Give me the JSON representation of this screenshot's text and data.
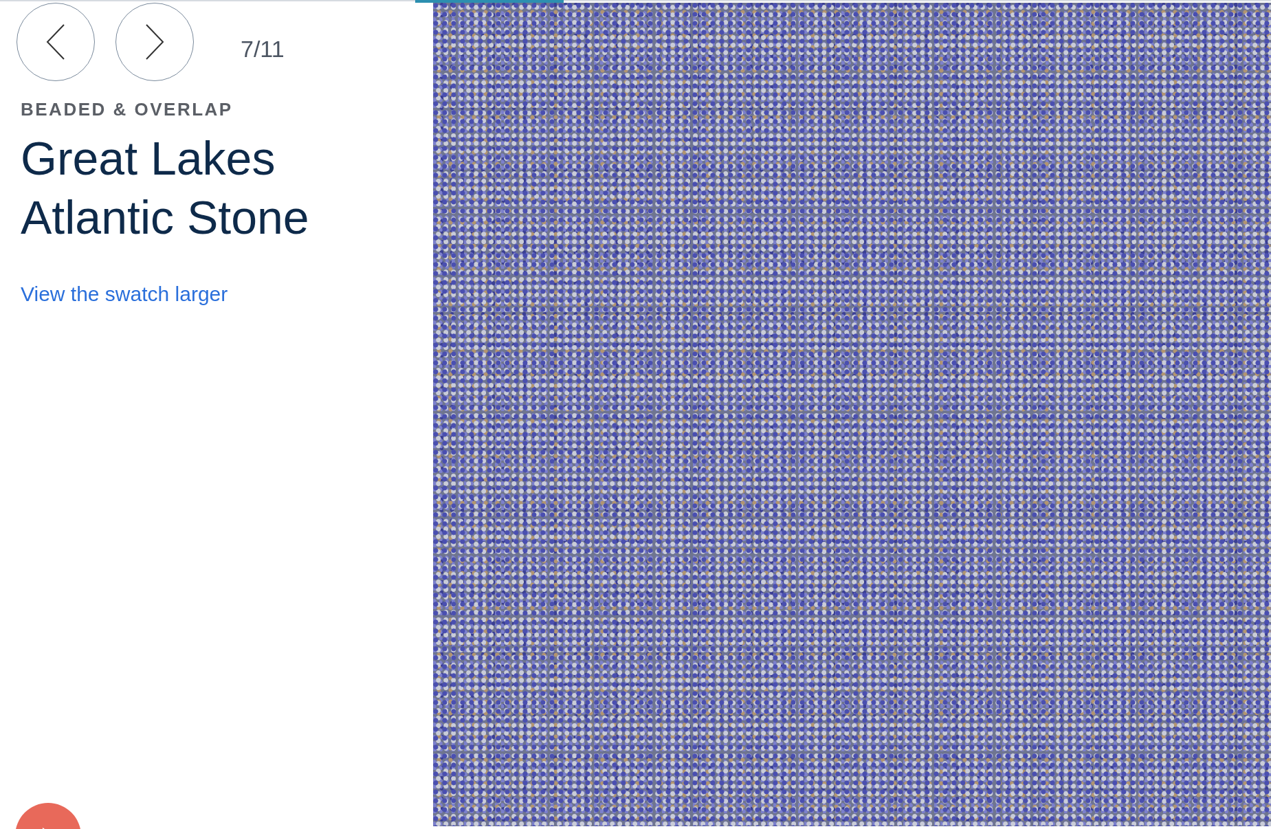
{
  "slider": {
    "counter": "7/11"
  },
  "product": {
    "category": "BEADED & OVERLAP",
    "title_lines": [
      "Great Lakes",
      "Atlantic Stone"
    ],
    "link": "View the swatch larger"
  }
}
